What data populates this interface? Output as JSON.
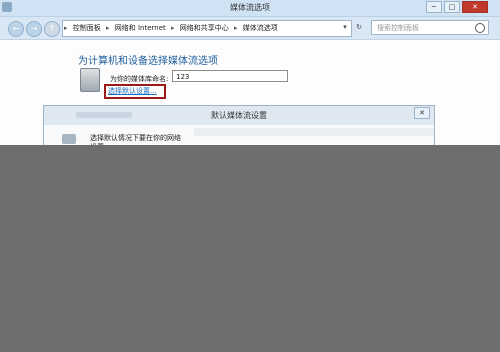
{
  "window": {
    "title": "媒体流选项",
    "controls": {
      "minimize": "─",
      "maximize": "□",
      "close": "✕"
    }
  },
  "nav": {
    "back": "←",
    "forward": "→",
    "up": "↑",
    "breadcrumbs": [
      "控制面板",
      "网络和 Internet",
      "网络和共享中心",
      "媒体流选项"
    ],
    "separator": "▸",
    "dropdown": "▾",
    "refresh": "↻",
    "search_placeholder": "搜索控制面板"
  },
  "main": {
    "heading": "为计算机和设备选择媒体流选项",
    "library_label": "为你的媒体库命名:",
    "library_value": "123",
    "default_settings_link": "选择默认设置..."
  },
  "dialog": {
    "title": "默认媒体流设置",
    "close": "✕",
    "text": "选择默认情况下要在你的网络",
    "text2": "设置"
  }
}
